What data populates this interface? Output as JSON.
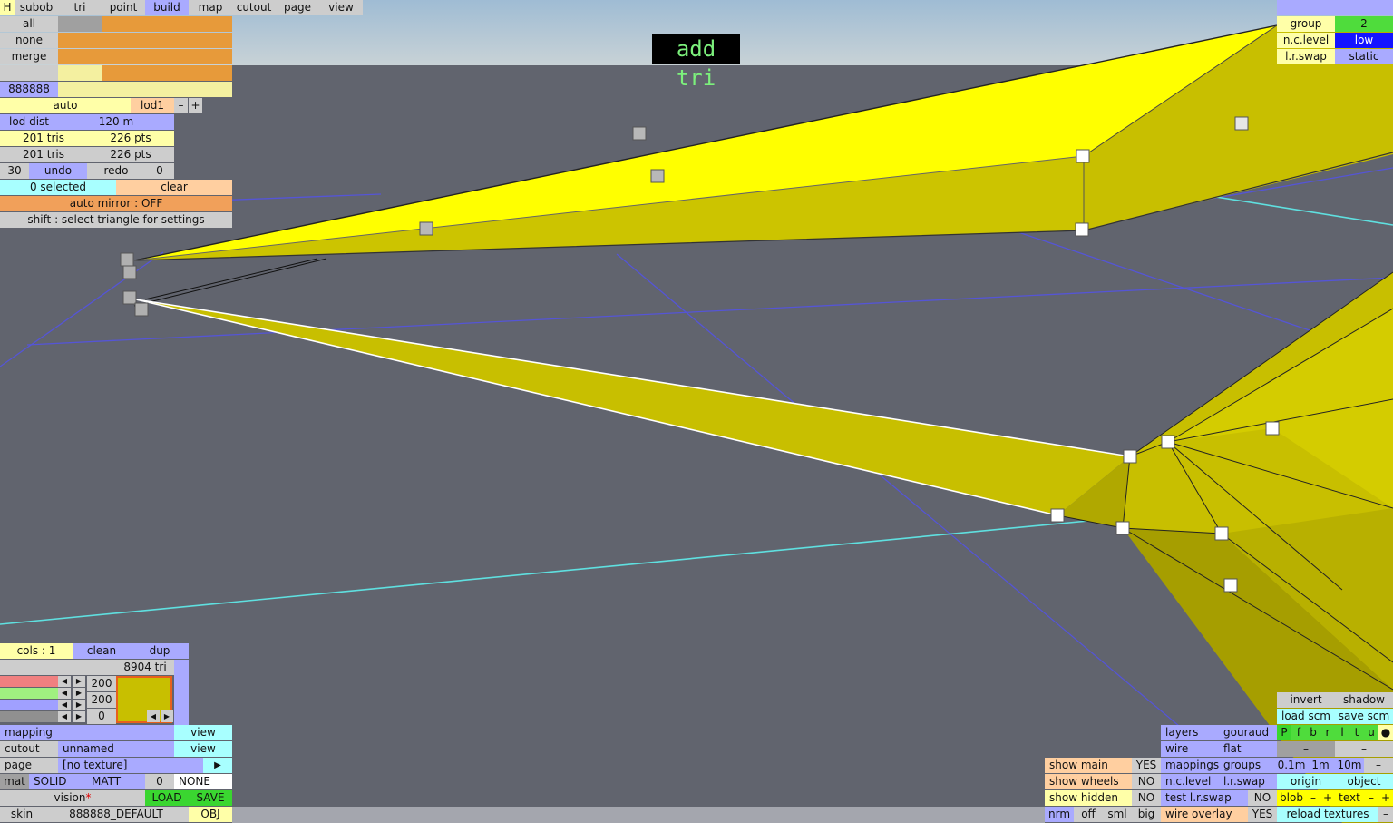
{
  "banner": "add tri",
  "menubar": [
    "H",
    "subob",
    "tri",
    "point",
    "build",
    "map",
    "cutout",
    "page",
    "view"
  ],
  "select_panel": {
    "all": "all",
    "none": "none",
    "merge": "merge",
    "minus": "–",
    "color_code": "888888"
  },
  "lod": {
    "auto": "auto",
    "lod1": "lod1",
    "dec": "–",
    "inc": "+",
    "dist_label": "lod dist",
    "dist_value": "120 m"
  },
  "stats": {
    "tris_a": "201 tris",
    "pts_a": "226 pts",
    "tris_b": "201 tris",
    "pts_b": "226 pts"
  },
  "history": {
    "count": "30",
    "undo": "undo",
    "redo": "redo",
    "redo_count": "0"
  },
  "selection": {
    "selected": "0 selected",
    "clear": "clear",
    "mirror": "auto mirror : OFF",
    "hint": "shift : select triangle for settings"
  },
  "group_panel": {
    "group_label": "group",
    "group_value": "2",
    "nclevel_label": "n.c.level",
    "nclevel_value": "low",
    "lrswap_label": "l.r.swap",
    "lrswap_value": "static"
  },
  "material": {
    "cols": "cols : 1",
    "clean": "clean",
    "dup": "dup",
    "tri_count": "8904 tri",
    "slider_a": "200",
    "slider_b": "200",
    "slider_c": "0",
    "swatch_color": "#c8bf00",
    "mapping_label": "mapping",
    "mapping_view": "view",
    "cutout_label": "cutout",
    "cutout_value": "unnamed",
    "cutout_view": "view",
    "page_label": "page",
    "page_value": "[no texture]",
    "mat_label": "mat",
    "mat_solid": "SOLID",
    "mat_matt": "MATT",
    "mat_num": "0",
    "mat_none": "NONE",
    "vision": "vision",
    "vision_star": "*",
    "load": "LOAD",
    "save": "SAVE",
    "skin_label": "skin",
    "skin_value": "888888_DEFAULT",
    "obj": "OBJ"
  },
  "view_panel": {
    "show_main": "show main",
    "show_main_v": "YES",
    "show_wheels": "show wheels",
    "show_wheels_v": "NO",
    "show_hidden": "show hidden",
    "show_hidden_v": "NO",
    "nrm": "nrm",
    "off": "off",
    "sml": "sml",
    "big": "big",
    "layers": "layers",
    "gouraud": "gouraud",
    "wire": "wire",
    "flat": "flat",
    "mappings": "mappings",
    "groups": "groups",
    "nclevel": "n.c.level",
    "lrswap": "l.r.swap",
    "test_lrswap": "test l.r.swap",
    "test_lrswap_v": "NO",
    "wire_overlay": "wire overlay",
    "wire_overlay_v": "YES"
  },
  "tools_panel": {
    "invert": "invert",
    "shadow": "shadow",
    "load_scm": "load scm",
    "save_scm": "save scm",
    "flags": [
      "P",
      "f",
      "b",
      "r",
      "l",
      "t",
      "u",
      "●"
    ],
    "dash1": "–",
    "dash2": "–",
    "s01": "0.1m",
    "s1": "1m",
    "s10": "10m",
    "sminus": "–",
    "origin": "origin",
    "object": "object",
    "blob": "blob",
    "blob_minus": "–",
    "blob_plus": "+",
    "text": "text",
    "text_minus": "–",
    "text_plus": "+",
    "reload": "reload textures",
    "reload_minus": "–"
  },
  "colors": {
    "sky": "#a7bfd3",
    "viewport": "#61646e",
    "mesh_light": "#ffff00",
    "mesh_mid": "#c8bf00",
    "mesh_dark": "#a09800"
  }
}
